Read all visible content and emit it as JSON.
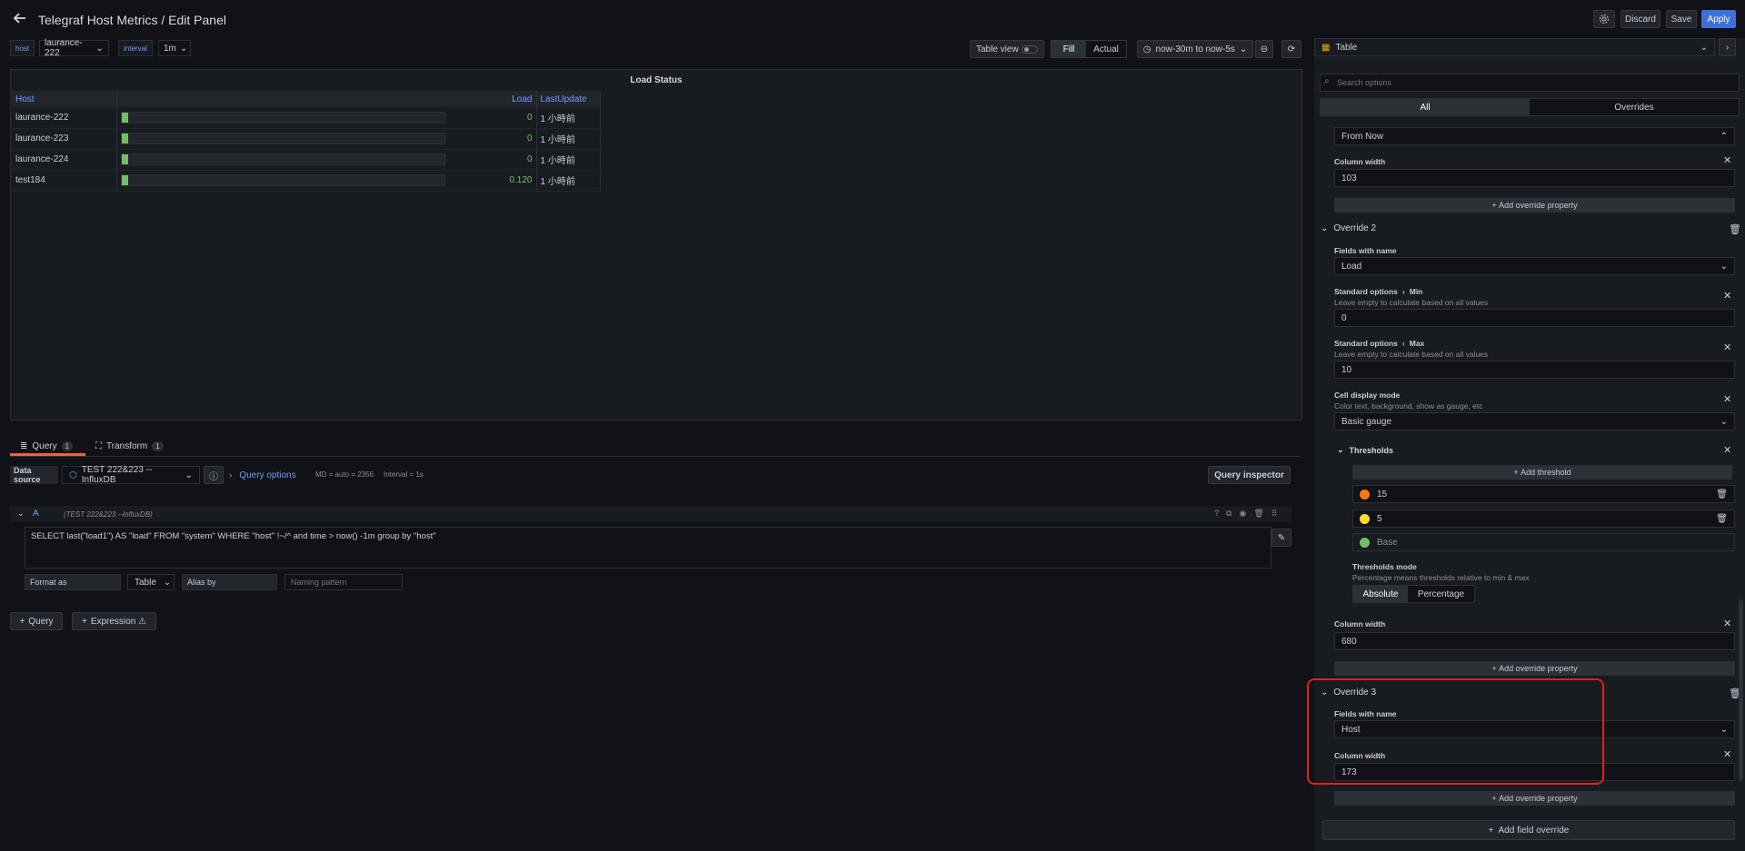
{
  "header": {
    "title": "Telegraf Host Metrics / Edit Panel",
    "discard": "Discard",
    "save": "Save",
    "apply": "Apply"
  },
  "vars": [
    {
      "label": "host",
      "value": "laurance-222"
    },
    {
      "label": "interval",
      "value": "1m"
    }
  ],
  "toolbar": {
    "table_view": "Table view",
    "fill": "Fill",
    "actual": "Actual",
    "time_range": "now-30m to now-5s"
  },
  "viz": {
    "name": "Table"
  },
  "panel": {
    "title": "Load Status",
    "columns": [
      "Host",
      "Load",
      "LastUpdate"
    ],
    "rows": [
      {
        "host": "laurance-222",
        "load": "0",
        "load_frac": 0.0,
        "updated": "1 小時前"
      },
      {
        "host": "laurance-223",
        "load": "0",
        "load_frac": 0.0,
        "updated": "1 小時前"
      },
      {
        "host": "laurance-224",
        "load": "0",
        "load_frac": 0.0,
        "updated": "1 小時前"
      },
      {
        "host": "test184",
        "load": "0.120",
        "load_frac": 0.012,
        "updated": "1 小時前"
      }
    ]
  },
  "query_tabs": {
    "query": "Query",
    "query_count": "1",
    "transform": "Transform",
    "transform_count": "1"
  },
  "datasource": {
    "label": "Data source",
    "value": "TEST 222&223 --InfluxDB",
    "query_options": "Query options",
    "meta_md": "MD = auto = 2356",
    "meta_interval": "Interval = 1s",
    "inspector": "Query inspector"
  },
  "query": {
    "ref": "A",
    "source": "(TEST 222&223 --InfluxDB)",
    "text": "SELECT last(\"load1\") AS \"load\" FROM \"system\" WHERE  \"host\" !~/^          and time > now() -1m group by \"host\"",
    "format_label": "Format as",
    "format_value": "Table",
    "alias_label": "Alias by",
    "alias_placeholder": "Naming pattern",
    "add_query": "Query",
    "add_expression": "Expression ⚠"
  },
  "options": {
    "search_placeholder": "Search options",
    "tab_all": "All",
    "tab_overrides": "Overrides",
    "override1": {
      "select": "From Now",
      "col_width_label": "Column width",
      "col_width": "103",
      "add_prop": "Add override property"
    },
    "override2": {
      "title": "Override 2",
      "fields_label": "Fields with name",
      "fields_value": "Load",
      "min_label_a": "Standard options",
      "min_label_b": "Min",
      "min_desc": "Leave empty to calculate based on all values",
      "min_value": "0",
      "max_label_a": "Standard options",
      "max_label_b": "Max",
      "max_desc": "Leave empty to calculate based on all values",
      "max_value": "10",
      "cell_label": "Cell display mode",
      "cell_desc": "Color text, background, show as gauge, etc",
      "cell_value": "Basic gauge",
      "thresholds_label": "Thresholds",
      "add_threshold": "Add threshold",
      "thresholds": [
        {
          "value": "15",
          "color": "#ff780a"
        },
        {
          "value": "5",
          "color": "#fade2a"
        },
        {
          "value": "Base",
          "color": "#73bf69"
        }
      ],
      "mode_label": "Thresholds mode",
      "mode_desc": "Percentage means thresholds relative to min & max",
      "mode_abs": "Absolute",
      "mode_pct": "Percentage",
      "col_width_label": "Column width",
      "col_width": "680",
      "add_prop": "Add override property"
    },
    "override3": {
      "title": "Override 3",
      "fields_label": "Fields with name",
      "fields_value": "Host",
      "col_width_label": "Column width",
      "col_width": "173",
      "add_prop": "Add override property"
    },
    "add_field_override": "Add field override"
  }
}
